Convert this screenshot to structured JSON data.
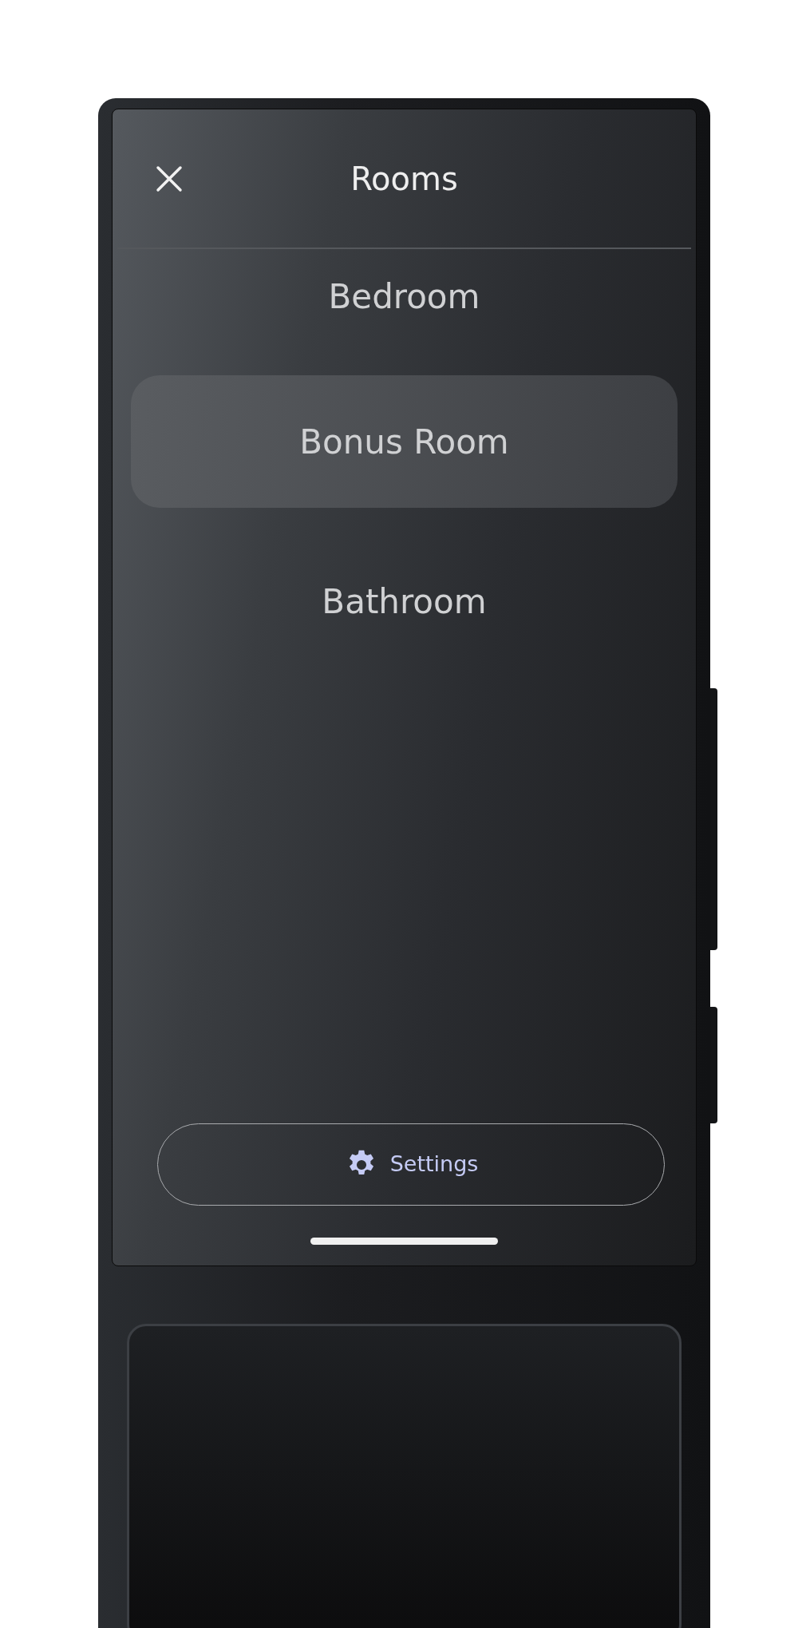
{
  "header": {
    "title": "Rooms"
  },
  "rooms": [
    {
      "label": "Bedroom",
      "selected": false
    },
    {
      "label": "Bonus Room",
      "selected": true
    },
    {
      "label": "Bathroom",
      "selected": false
    }
  ],
  "settings_button": {
    "label": "Settings"
  }
}
